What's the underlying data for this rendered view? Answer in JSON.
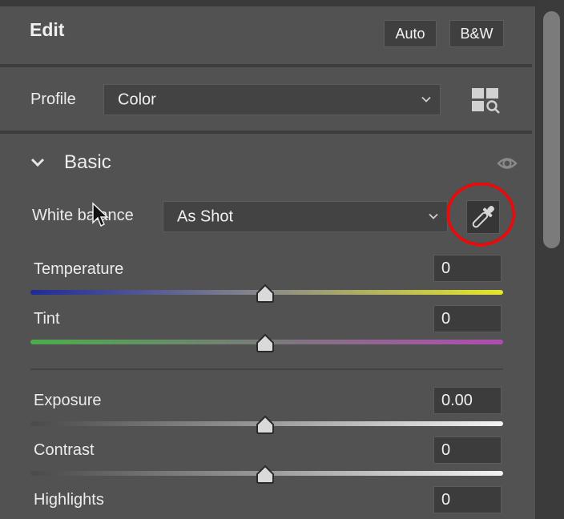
{
  "panel": {
    "title": "Edit",
    "buttons": [
      {
        "label": "Auto"
      },
      {
        "label": "B&W"
      }
    ]
  },
  "profile": {
    "label": "Profile",
    "value": "Color",
    "browse_icon": "profile-browser-grid-icon"
  },
  "basic": {
    "title": "Basic",
    "expanded": true,
    "visibility_icon": "eye-icon",
    "white_balance": {
      "label": "White balance",
      "value": "As Shot",
      "eyedropper_icon": "eyedropper-icon",
      "highlight_color": "#e00f0f"
    },
    "sliders": [
      {
        "label": "Temperature",
        "value": "0",
        "position": 0.5,
        "gradient": [
          "#1f2a9a",
          "#8a8a8a",
          "#e6e62a"
        ]
      },
      {
        "label": "Tint",
        "value": "0",
        "position": 0.5,
        "gradient": [
          "#4cac4c",
          "#7a7a7a",
          "#b04cb0"
        ]
      },
      {
        "label": "Exposure",
        "value": "0.00",
        "position": 0.5,
        "gradient": [
          "#4a4a4a",
          "#9a9a9a",
          "#f4f4f4"
        ]
      },
      {
        "label": "Contrast",
        "value": "0",
        "position": 0.5,
        "gradient": [
          "#4a4a4a",
          "#9a9a9a",
          "#f4f4f4"
        ]
      },
      {
        "label": "Highlights",
        "value": "0",
        "position": 0.5,
        "gradient": [
          "#4a4a4a",
          "#9a9a9a",
          "#f4f4f4"
        ]
      }
    ]
  },
  "scrollbar": {
    "position": 0.0
  }
}
